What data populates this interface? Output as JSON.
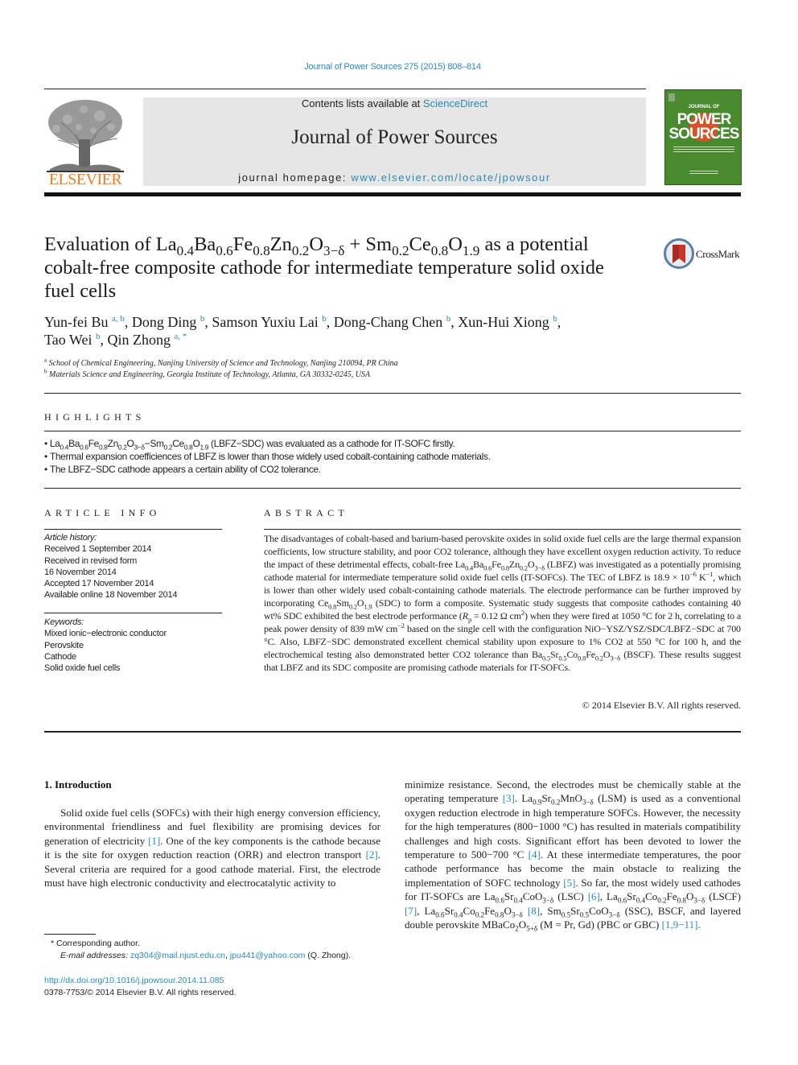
{
  "header": {
    "citation": "Journal of Power Sources 275 (2015) 808–814",
    "publisher_logo_text": "ELSEVIER",
    "contents_prefix": "Contents lists available at ",
    "contents_link": "ScienceDirect",
    "journal_title": "Journal of Power Sources",
    "homepage_prefix": "journal homepage: ",
    "homepage_link": "www.elsevier.com/locate/jpowsour",
    "cover_top": "JOURNAL OF",
    "cover_title_1": "POWER",
    "cover_title_2": "SOURCES"
  },
  "article": {
    "title_pre": "Evaluation of La",
    "title_parts": [
      {
        "t": "La"
      },
      {
        "s": "0.4"
      },
      {
        "t": "Ba"
      },
      {
        "s": "0.6"
      },
      {
        "t": "Fe"
      },
      {
        "s": "0.8"
      },
      {
        "t": "Zn"
      },
      {
        "s": "0.2"
      },
      {
        "t": "O"
      },
      {
        "s": "3−δ"
      },
      {
        "t": " + Sm"
      },
      {
        "s": "0.2"
      },
      {
        "t": "Ce"
      },
      {
        "s": "0.8"
      },
      {
        "t": "O"
      },
      {
        "s": "1.9"
      }
    ],
    "title_lead": "Evaluation of ",
    "title_tail": " as a potential cobalt-free composite cathode for intermediate temperature solid oxide fuel cells",
    "crossmark_label": "CrossMark",
    "authors": [
      {
        "name": "Yun-fei Bu",
        "aff": "a, b"
      },
      {
        "name": "Dong Ding",
        "aff": "b"
      },
      {
        "name": "Samson Yuxiu Lai",
        "aff": "b"
      },
      {
        "name": "Dong-Chang Chen",
        "aff": "b"
      },
      {
        "name": "Xun-Hui Xiong",
        "aff": "b"
      },
      {
        "name": "Tao Wei",
        "aff": "b"
      },
      {
        "name": "Qin Zhong",
        "aff": "a, *"
      }
    ],
    "affiliations": [
      {
        "key": "a",
        "text": "School of Chemical Engineering, Nanjing University of Science and Technology, Nanjing 210094, PR China"
      },
      {
        "key": "b",
        "text": "Materials Science and Engineering, Georgia Institute of Technology, Atlanta, GA 30332-0245, USA"
      }
    ]
  },
  "highlights": {
    "heading": "HIGHLIGHTS",
    "items": [
      "La0.4Ba0.6Fe0.8Zn0.2O3−δ−Sm0.2Ce0.8O1.9 (LBFZ−SDC) was evaluated as a cathode for IT-SOFC firstly.",
      "Thermal expansion coefficiences of LBFZ is lower than those widely used cobalt-containing cathode materials.",
      "The LBFZ−SDC cathode appears a certain ability of CO2 tolerance."
    ]
  },
  "article_info": {
    "heading": "ARTICLE INFO",
    "history_label": "Article history:",
    "history": [
      "Received 1 September 2014",
      "Received in revised form",
      "16 November 2014",
      "Accepted 17 November 2014",
      "Available online 18 November 2014"
    ],
    "keywords_label": "Keywords:",
    "keywords": [
      "Mixed ionic−electronic conductor",
      "Perovskite",
      "Cathode",
      "Solid oxide fuel cells"
    ]
  },
  "abstract": {
    "heading": "ABSTRACT",
    "text": "The disadvantages of cobalt-based and barium-based perovskite oxides in solid oxide fuel cells are the large thermal expansion coefficients, low structure stability, and poor CO2 tolerance, although they have excellent oxygen reduction activity. To reduce the impact of these detrimental effects, cobalt-free La0.4Ba0.6Fe0.8Zn0.2O3−δ (LBFZ) was investigated as a potentially promising cathode material for intermediate temperature solid oxide fuel cells (IT-SOFCs). The TEC of LBFZ is 18.9 × 10−6 K−1, which is lower than other widely used cobalt-containing cathode materials. The electrode performance can be further improved by incorporating Ce0.8Sm0.2O1.9 (SDC) to form a composite. Systematic study suggests that composite cathodes containing 40 wt% SDC exhibited the best electrode performance (Rp = 0.12 Ω cm2) when they were fired at 1050 °C for 2 h, correlating to a peak power density of 839 mW cm−2 based on the single cell with the configuration NiO−YSZ/YSZ/SDC/LBFZ−SDC at 700 °C. Also, LBFZ−SDC demonstrated excellent chemical stability upon exposure to 1% CO2 at 550 °C for 100 h, and the electrochemical testing also demonstrated better CO2 tolerance than Ba0.5Sr0.5Co0.8Fe0.2O3−δ (BSCF). These results suggest that LBFZ and its SDC composite are promising cathode materials for IT-SOFCs.",
    "copyright": "© 2014 Elsevier B.V. All rights reserved."
  },
  "introduction": {
    "heading": "1.  Introduction",
    "left_text": [
      {
        "t": "Solid oxide fuel cells (SOFCs) with their high energy conversion efficiency, environmental friendliness and fuel flexibility are promising devices for generation of electricity "
      },
      {
        "ref": "[1]"
      },
      {
        "t": ". One of the key components is the cathode because it is the site for oxygen reduction reaction (ORR) and electron transport "
      },
      {
        "ref": "[2]"
      },
      {
        "t": ". Several criteria are required for a good cathode material. First, the electrode must have high electronic conductivity and electrocatalytic activity to"
      }
    ],
    "right_text": [
      {
        "t": "minimize resistance. Second, the electrodes must be chemically stable at the operating temperature "
      },
      {
        "ref": "[3]"
      },
      {
        "t": ". La"
      },
      {
        "s": "0.9"
      },
      {
        "t": "Sr"
      },
      {
        "s": "0.2"
      },
      {
        "t": "MnO"
      },
      {
        "s": "3−δ"
      },
      {
        "t": " (LSM) is used as a conventional oxygen reduction electrode in high temperature SOFCs. However, the necessity for the high temperatures (800−1000 °C) has resulted in materials compatibility challenges and high costs. Significant effort has been devoted to lower the temperature to 500−700 °C "
      },
      {
        "ref": "[4]"
      },
      {
        "t": ". At these intermediate temperatures, the poor cathode performance has become the main obstacle to realizing the implementation of SOFC technology "
      },
      {
        "ref": "[5]"
      },
      {
        "t": ". So far, the most widely used cathodes for IT-SOFCs are La"
      },
      {
        "s": "0.6"
      },
      {
        "t": "Sr"
      },
      {
        "s": "0.4"
      },
      {
        "t": "CoO"
      },
      {
        "s": "3−δ"
      },
      {
        "t": " (LSC) "
      },
      {
        "ref": "[6]"
      },
      {
        "t": ", La"
      },
      {
        "s": "0.6"
      },
      {
        "t": "Sr"
      },
      {
        "s": "0.4"
      },
      {
        "t": "Co"
      },
      {
        "s": "0.2"
      },
      {
        "t": "Fe"
      },
      {
        "s": "0.8"
      },
      {
        "t": "O"
      },
      {
        "s": "3−δ"
      },
      {
        "t": " (LSCF) "
      },
      {
        "ref": "[7]"
      },
      {
        "t": ", La"
      },
      {
        "s": "0.6"
      },
      {
        "t": "Sr"
      },
      {
        "s": "0.4"
      },
      {
        "t": "Co"
      },
      {
        "s": "0.2"
      },
      {
        "t": "Fe"
      },
      {
        "s": "0.8"
      },
      {
        "t": "O"
      },
      {
        "s": "3−δ"
      },
      {
        "t": " "
      },
      {
        "ref": "[8]"
      },
      {
        "t": ", Sm"
      },
      {
        "s": "0.5"
      },
      {
        "t": "Sr"
      },
      {
        "s": "0.5"
      },
      {
        "t": "CoO"
      },
      {
        "s": "3−δ"
      },
      {
        "t": " (SSC), BSCF, and layered double perovskite MBaCo"
      },
      {
        "s": "2"
      },
      {
        "t": "O"
      },
      {
        "s": "5+δ"
      },
      {
        "t": " (M = Pr, Gd) (PBC or GBC) "
      },
      {
        "ref": "[1,9−11]"
      },
      {
        "t": "."
      }
    ]
  },
  "footnotes": {
    "corresponding": "* Corresponding author.",
    "email_label": "E-mail addresses: ",
    "email_1": "zq304@mail.njust.edu.cn",
    "email_sep": ", ",
    "email_2": "jpu441@yahoo.com",
    "email_suffix": " (Q. Zhong).",
    "doi": "http://dx.doi.org/10.1016/j.jpowsour.2014.11.085",
    "issn": "0378-7753/© 2014 Elsevier B.V. All rights reserved."
  },
  "colors": {
    "link": "#2a8ab8",
    "elsevier_orange": "#f47a20",
    "cover_green": "#4a8a2e",
    "banner_gray": "#e6e6e6"
  }
}
